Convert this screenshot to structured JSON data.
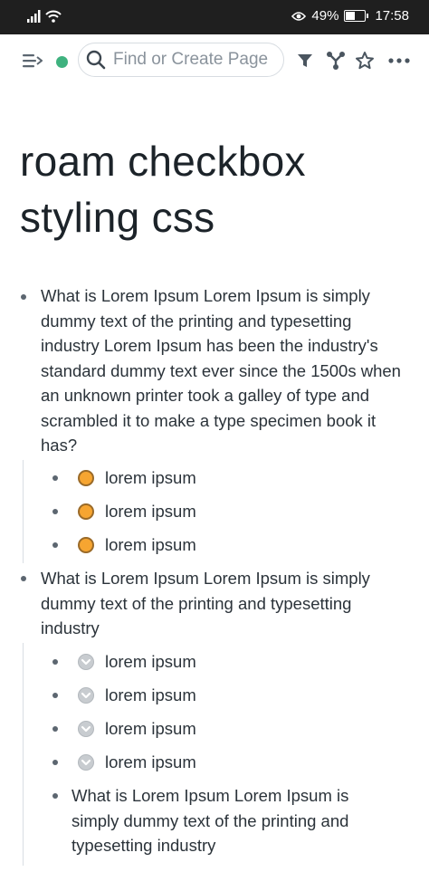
{
  "status_bar": {
    "battery_percent": "49%",
    "battery_level": 0.49,
    "time": "17:58"
  },
  "toolbar": {
    "search_placeholder": "Find or Create Page",
    "sync_color": "#3fb27f"
  },
  "page": {
    "title": "roam checkbox styling css"
  },
  "blocks": [
    {
      "text": "What is Lorem Ipsum Lorem Ipsum is simply dummy text of the printing and typesetting industry Lorem Ipsum has been the industry's standard dummy text ever since the 1500s when an unknown printer took a galley of type and scrambled it to make a type specimen book it has?",
      "children": [
        {
          "checkbox": "todo",
          "text": "lorem ipsum"
        },
        {
          "checkbox": "todo",
          "text": "lorem ipsum"
        },
        {
          "checkbox": "todo",
          "text": "lorem ipsum"
        }
      ]
    },
    {
      "text": "What is Lorem Ipsum Lorem Ipsum is simply dummy text of the printing and typesetting industry",
      "children": [
        {
          "checkbox": "done",
          "text": "lorem ipsum"
        },
        {
          "checkbox": "done",
          "text": "lorem ipsum"
        },
        {
          "checkbox": "done",
          "text": "lorem ipsum"
        },
        {
          "checkbox": "done",
          "text": "lorem ipsum"
        },
        {
          "checkbox": "none",
          "text": "What is Lorem Ipsum Lorem Ipsum is simply dummy text of the printing and typesetting industry"
        }
      ]
    }
  ]
}
